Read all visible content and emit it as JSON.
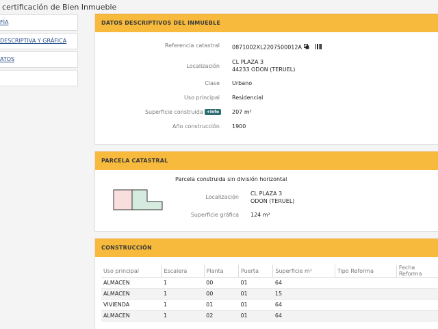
{
  "page": {
    "title": "certificación de Bien Inmueble"
  },
  "sidebar": {
    "items": [
      {
        "label": "FÍA"
      },
      {
        "label": "DESCRIPTIVA Y GRÁFICA"
      },
      {
        "label": "ATOS"
      },
      {
        "label": ""
      }
    ]
  },
  "datos": {
    "header": "DATOS DESCRIPTIVOS DEL INMUEBLE",
    "ref_label": "Referencia catastral",
    "ref_value": "0871002XL2207500012A",
    "loc_label": "Localización",
    "loc_line1": "CL PLAZA 3",
    "loc_line2": "44233 ODON (TERUEL)",
    "clase_label": "Clase",
    "clase_value": "Urbano",
    "uso_label": "Uso principal",
    "uso_value": "Residencial",
    "sup_label": "Superficie construida",
    "sup_badge": "+Info",
    "sup_value": "207 m²",
    "anio_label": "Año construcción",
    "anio_value": "1900"
  },
  "parcela": {
    "header": "PARCELA CATASTRAL",
    "subtitle": "Parcela construida sin división horizontal",
    "loc_label": "Localización",
    "loc_line1": "CL PLAZA 3",
    "loc_line2": "ODON (TERUEL)",
    "sup_label": "Superficie gráfica",
    "sup_value": "124 m²"
  },
  "construccion": {
    "header": "CONSTRUCCIÓN",
    "columns": [
      "Uso principal",
      "Escalera",
      "Planta",
      "Puerta",
      "Superficie m²",
      "Tipo Reforma",
      "Fecha Reforma"
    ],
    "rows": [
      [
        "ALMACEN",
        "1",
        "00",
        "01",
        "64",
        "",
        ""
      ],
      [
        "ALMACEN",
        "1",
        "00",
        "01",
        "15",
        "",
        ""
      ],
      [
        "VIVIENDA",
        "1",
        "01",
        "01",
        "64",
        "",
        ""
      ],
      [
        "ALMACEN",
        "1",
        "02",
        "01",
        "64",
        "",
        ""
      ]
    ]
  },
  "icons": {
    "copy": "copy-icon",
    "barcode": "barcode-icon"
  },
  "colors": {
    "header": "#f7ba3c",
    "badge": "#2e6e73",
    "link": "#2a4f8a"
  }
}
